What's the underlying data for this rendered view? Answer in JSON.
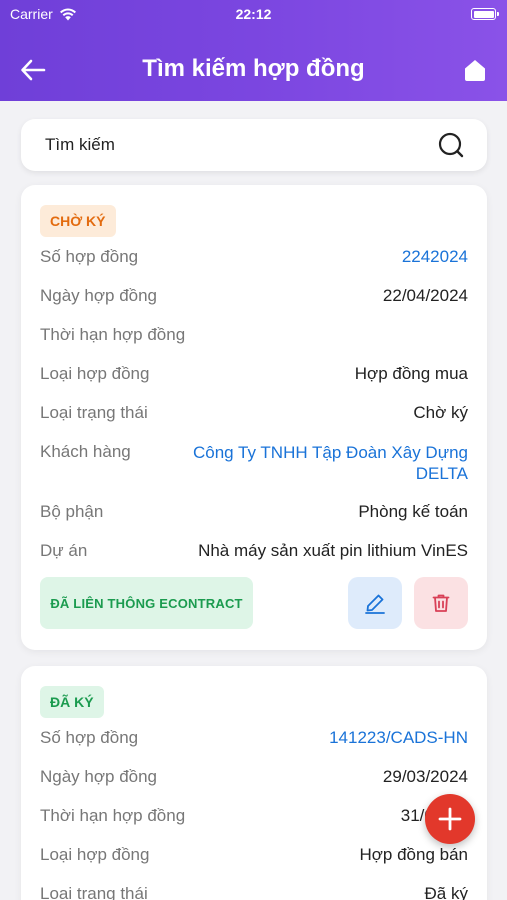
{
  "status_bar": {
    "carrier": "Carrier",
    "time": "22:12"
  },
  "header": {
    "title": "Tìm kiếm hợp đồng"
  },
  "search": {
    "placeholder": "Tìm kiếm"
  },
  "contracts": [
    {
      "status": "CHỜ KÝ",
      "fields": {
        "so_hop_dong": {
          "label": "Số hợp đồng",
          "value": "2242024"
        },
        "ngay_hop_dong": {
          "label": "Ngày hợp đồng",
          "value": "22/04/2024"
        },
        "thoi_han": {
          "label": "Thời hạn hợp đồng",
          "value": ""
        },
        "loai_hop_dong": {
          "label": "Loại hợp đồng",
          "value": "Hợp đồng mua"
        },
        "loai_trang_thai": {
          "label": "Loại trạng thái",
          "value": "Chờ ký"
        },
        "khach_hang": {
          "label": "Khách hàng",
          "value": "Công Ty TNHH Tập Đoàn Xây Dựng DELTA"
        },
        "bo_phan": {
          "label": "Bộ phận",
          "value": "Phòng kế toán"
        },
        "du_an": {
          "label": "Dự án",
          "value": "Nhà máy sản xuất pin lithium VinES"
        }
      },
      "econtract_label": "ĐÃ LIÊN THÔNG ECONTRACT"
    },
    {
      "status": "ĐÃ KÝ",
      "fields": {
        "so_hop_dong": {
          "label": "Số hợp đồng",
          "value": "141223/CADS-HN"
        },
        "ngay_hop_dong": {
          "label": "Ngày hợp đồng",
          "value": "29/03/2024"
        },
        "thoi_han": {
          "label": "Thời hạn hợp đồng",
          "value": "31/03/"
        },
        "loai_hop_dong": {
          "label": "Loại hợp đồng",
          "value": "Hợp đồng bán"
        },
        "loai_trang_thai": {
          "label": "Loại trạng thái",
          "value": "Đã ký"
        }
      }
    }
  ],
  "colors": {
    "header": "#7b46e0",
    "link": "#1a73d8",
    "pending": "#e36b0f",
    "signed": "#1b9b4f",
    "fab": "#e2382b"
  },
  "icons": [
    "wifi-icon",
    "battery-icon",
    "back-arrow-icon",
    "home-icon",
    "search-icon",
    "edit-icon",
    "trash-icon",
    "plus-icon"
  ]
}
